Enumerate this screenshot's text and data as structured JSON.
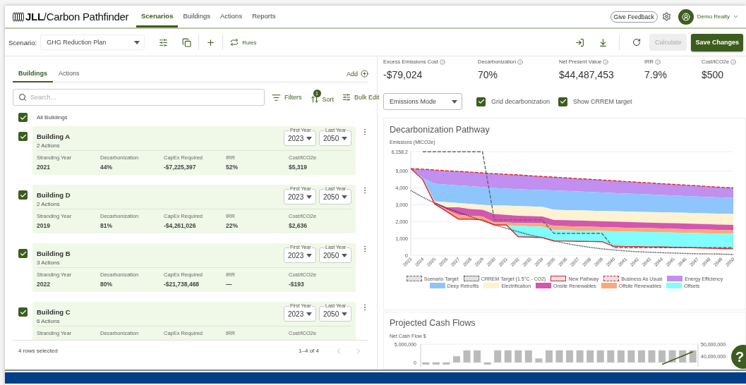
{
  "header": {
    "logo": "**JLL**/Carbon Pathfinder",
    "nav": [
      {
        "label": "Scenarios",
        "selected": true
      },
      {
        "label": "Buildings",
        "selected": false
      },
      {
        "label": "Actions",
        "selected": false
      },
      {
        "label": "Reports",
        "selected": false
      }
    ],
    "feedback": "Give Feedback",
    "user": "Demo Realty"
  },
  "toolbar": {
    "scenario_label": "Scenario:",
    "scenario": "GHG Reduction Plan",
    "rules": "Rules",
    "calculate": {
      "label": "Calculate",
      "disabled": true
    },
    "save": {
      "label": "Save Changes",
      "disabled": false
    }
  },
  "buildings_panel": {
    "tabs": [
      {
        "label": "Buildings",
        "selected": true
      },
      {
        "label": "Actions",
        "selected": false
      }
    ],
    "add": "Add",
    "search": {
      "placeholder": "Search…"
    },
    "filters": "Filters",
    "sort": {
      "label": "Sort",
      "badge": "1"
    },
    "bulk_edit": "Bulk Edit",
    "all": {
      "label": "All Buildings",
      "checked": true
    },
    "buildings": [
      {
        "name": "Building A",
        "actions": "2 Actions",
        "checked": true,
        "first_year": {
          "label": "First Year",
          "value": "2023"
        },
        "last_year": {
          "label": "Last Year",
          "value": "2050"
        },
        "metrics": [
          {
            "label": "Stranding Year",
            "value": "2021"
          },
          {
            "label": "Decarbonization",
            "value": "44%"
          },
          {
            "label": "CapEx Required",
            "value": "-$7,225,397"
          },
          {
            "label": "IRR",
            "value": "52%"
          },
          {
            "label": "Cost/tCO2e",
            "value": "$5,319"
          }
        ]
      },
      {
        "name": "Building D",
        "actions": "2 Actions",
        "checked": true,
        "first_year": {
          "label": "First Year",
          "value": "2023"
        },
        "last_year": {
          "label": "Last Year",
          "value": "2050"
        },
        "metrics": [
          {
            "label": "Stranding Year",
            "value": "2019"
          },
          {
            "label": "Decarbonization",
            "value": "81%"
          },
          {
            "label": "CapEx Required",
            "value": "-$4,261,026"
          },
          {
            "label": "IRR",
            "value": "22%"
          },
          {
            "label": "Cost/tCO2e",
            "value": "$2,636"
          }
        ]
      },
      {
        "name": "Building B",
        "actions": "3 Actions",
        "checked": true,
        "first_year": {
          "label": "First Year",
          "value": "2023"
        },
        "last_year": {
          "label": "Last Year",
          "value": "2050"
        },
        "metrics": [
          {
            "label": "Stranding Year",
            "value": "2022"
          },
          {
            "label": "Decarbonization",
            "value": "80%"
          },
          {
            "label": "CapEx Required",
            "value": "-$21,738,468"
          },
          {
            "label": "IRR",
            "value": "—"
          },
          {
            "label": "Cost/tCO2e",
            "value": "-$193"
          }
        ]
      },
      {
        "name": "Building C",
        "actions": "6 Actions",
        "checked": true,
        "first_year": {
          "label": "First Year",
          "value": "2023"
        },
        "last_year": {
          "label": "Last Year",
          "value": "2050"
        },
        "metrics": [
          {
            "label": "Stranding Year"
          },
          {
            "label": "Decarbonization"
          },
          {
            "label": "CapEx Required"
          },
          {
            "label": "IRR"
          },
          {
            "label": "Cost/tCO2e"
          }
        ]
      }
    ],
    "footer": {
      "selected": "4 rows selected",
      "range": "1–4 of 4"
    }
  },
  "summary": {
    "metrics": [
      {
        "label": "Excess Emissions Cost",
        "value": "-$79,024"
      },
      {
        "label": "Decarbonization",
        "value": "70%"
      },
      {
        "label": "Net Present Value",
        "value": "$44,487,453"
      },
      {
        "label": "IRR",
        "value": "7.9%"
      },
      {
        "label": "Cost/tCO2e",
        "value": "$500"
      }
    ]
  },
  "controls": {
    "mode": "Emissions Mode",
    "options": [
      {
        "label": "Grid decarbonization",
        "checked": true
      },
      {
        "label": "Show CRREM target",
        "checked": true
      }
    ]
  },
  "decarbonization": {
    "chart_data": {
      "type": "area",
      "title": "Decarbonization Pathway",
      "ylabel": "Emissions (MtCO2e)",
      "stacked": false,
      "x": [
        "2023",
        "2024",
        "2025",
        "2026",
        "2027",
        "2028",
        "2029",
        "2030",
        "2031",
        "2032",
        "2033",
        "2034",
        "2035",
        "2036",
        "2037",
        "2038",
        "2039",
        "2040",
        "2041",
        "2042",
        "2043",
        "2044",
        "2045",
        "2046",
        "2047",
        "2048",
        "2049",
        "2050"
      ],
      "ylim": [
        0,
        6158.2
      ],
      "grid": true,
      "legend": "bottom",
      "yticks": [
        {
          "value": 0,
          "label": "0"
        },
        {
          "value": 1000,
          "label": "1,000"
        },
        {
          "value": 2000,
          "label": "2,000"
        },
        {
          "value": 3000,
          "label": "3,000"
        },
        {
          "value": 4000,
          "label": "4,000"
        },
        {
          "value": 5000,
          "label": "5,000"
        },
        {
          "value": 6158.2,
          "label": "6,158.2"
        }
      ],
      "series": [
        {
          "name": "Scenario Target",
          "type": "line",
          "line_style": "dashed",
          "color": "#666666",
          "values": [
            null,
            6150,
            6150,
            6150,
            6150,
            6150,
            6150,
            2100,
            2100,
            2100,
            2100,
            2100,
            1300,
            1300,
            1300,
            1300,
            1300,
            450,
            450,
            450,
            450,
            450,
            450,
            450,
            450,
            450,
            450,
            450
          ]
        },
        {
          "name": "CRREM Target (1.5°C - CO2)",
          "type": "line",
          "line_style": "dotted",
          "color": "#222222",
          "values": [
            3850,
            3450,
            3100,
            2800,
            2550,
            2300,
            2050,
            1800,
            1600,
            1400,
            1200,
            1050,
            850,
            700,
            580,
            470,
            380,
            320,
            250,
            210,
            180,
            150,
            130,
            110,
            90,
            80,
            70,
            50
          ]
        },
        {
          "name": "New Pathway",
          "type": "line",
          "line_style": "solid",
          "color": "#e0242b",
          "values": [
            5150,
            4500,
            3050,
            2600,
            2150,
            2150,
            2100,
            1800,
            1800,
            1100,
            1080,
            1050,
            850,
            840,
            830,
            820,
            810,
            530,
            520,
            510,
            500,
            490,
            470,
            460,
            440,
            420,
            400,
            380
          ]
        },
        {
          "name": "Business As Usual",
          "type": "line",
          "line_style": "dashed",
          "color": "#e0242b",
          "values": [
            5150,
            5110,
            5070,
            5020,
            4980,
            4940,
            4890,
            4850,
            4810,
            4770,
            4720,
            4680,
            4640,
            4600,
            4550,
            4510,
            4470,
            4430,
            4380,
            4340,
            4300,
            4250,
            4210,
            4170,
            4130,
            4080,
            4040,
            4000
          ]
        },
        {
          "name": "Energy Efficiency",
          "type": "area",
          "color": "#c08ff0",
          "values": [
            5150,
            5110,
            5070,
            5020,
            4980,
            4940,
            4890,
            4850,
            4810,
            4770,
            4720,
            4680,
            4640,
            4600,
            4550,
            4510,
            4470,
            4430,
            4380,
            4340,
            4300,
            4250,
            4210,
            4170,
            4130,
            4080,
            4040,
            4000
          ]
        },
        {
          "name": "Deep Retrofits",
          "type": "area",
          "color": "#8ec5fc",
          "values": [
            5150,
            4600,
            4250,
            4200,
            4150,
            4100,
            4050,
            4000,
            3960,
            3930,
            3900,
            3870,
            3850,
            3820,
            3790,
            3760,
            3730,
            3700,
            3670,
            3640,
            3610,
            3580,
            3550,
            3520,
            3490,
            3460,
            3430,
            3400
          ]
        },
        {
          "name": "Electrification",
          "type": "area",
          "color": "#fdf2d2",
          "values": [
            5150,
            4550,
            3200,
            3150,
            3100,
            3050,
            3000,
            2950,
            2950,
            2920,
            2900,
            2880,
            2700,
            2680,
            2670,
            2650,
            2630,
            2620,
            2600,
            2580,
            2570,
            2550,
            2530,
            2520,
            2500,
            2480,
            2470,
            2450
          ]
        },
        {
          "name": "Onsite Renewables",
          "type": "area",
          "color": "#d456b0",
          "values": [
            null,
            4500,
            3150,
            2850,
            2850,
            2750,
            2700,
            2450,
            2400,
            2350,
            2320,
            2300,
            2100,
            2080,
            2060,
            2040,
            2020,
            2000,
            1980,
            1960,
            1940,
            1920,
            1900,
            1880,
            1860,
            1840,
            1820,
            1800
          ]
        },
        {
          "name": "Offsite Renewables",
          "type": "area",
          "color": "#fba97a",
          "values": [
            null,
            4500,
            3100,
            2700,
            2400,
            2350,
            2300,
            1950,
            1950,
            1920,
            1910,
            1900,
            1750,
            1730,
            1710,
            1700,
            1680,
            1660,
            1640,
            1620,
            1610,
            1590,
            1570,
            1550,
            1540,
            1520,
            1500,
            1480
          ]
        },
        {
          "name": "Offsets",
          "type": "area",
          "color": "#80fdfd",
          "values": [
            null,
            null,
            null,
            null,
            null,
            null,
            null,
            null,
            1780,
            1750,
            1720,
            1700,
            1500,
            1490,
            1470,
            1460,
            1440,
            1420,
            1410,
            1390,
            1380,
            1360,
            1350,
            1330,
            1320,
            1300,
            1290,
            1270
          ]
        }
      ]
    }
  },
  "cash_flows": {
    "chart_data": {
      "type": "bar",
      "title": "Projected Cash Flows",
      "ylabel": "Net Cash Flow $",
      "ylim": [
        -1150000,
        5000000
      ],
      "yticks": [
        {
          "value": 0,
          "label": "0"
        },
        {
          "value": 5000000,
          "label": "5,000,000"
        }
      ],
      "y2lim": [
        32200000,
        50000000
      ],
      "y2ticks": [
        {
          "value": 40000000,
          "label": "40,000,000"
        },
        {
          "value": 50000000,
          "label": "50,000,000"
        }
      ],
      "series": [
        {
          "type": "bar",
          "color": "#bbbbbb",
          "values": [
            -600000,
            -600000,
            -600000,
            1700000,
            3300000,
            3300000,
            -600000,
            3300000,
            3300000,
            3300000,
            3300000,
            1100000,
            3300000,
            3300000,
            3300000,
            3300000,
            3300000,
            3300000,
            3300000,
            3300000,
            3300000,
            3300000,
            3300000,
            3300000,
            3300000,
            3300000,
            3300000
          ]
        },
        {
          "type": "line",
          "axis": "y2",
          "color": "#3d5d1e",
          "values": [
            null,
            null,
            null,
            null,
            null,
            null,
            null,
            null,
            null,
            null,
            null,
            null,
            null,
            null,
            null,
            null,
            null,
            null,
            null,
            null,
            null,
            null,
            null,
            34000000,
            37300000,
            40700000,
            44000000
          ]
        }
      ]
    }
  },
  "help": "?"
}
